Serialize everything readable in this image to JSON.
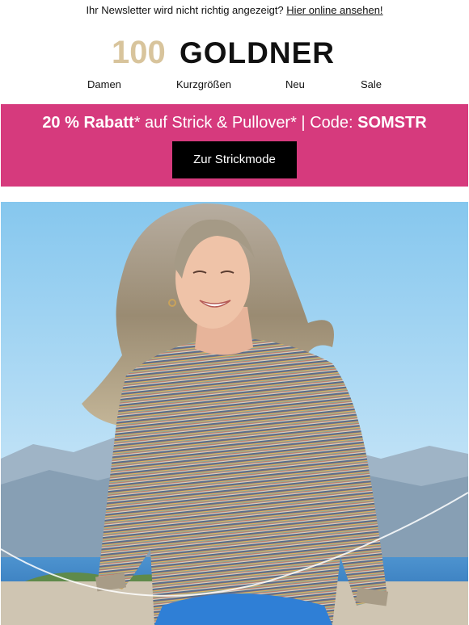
{
  "preheader": {
    "text": "Ihr Newsletter wird nicht richtig angezeigt?",
    "link": "Hier online ansehen!"
  },
  "brand": {
    "anniversary": "100",
    "name": "GOLDNER",
    "gold_color": "#d8c49c"
  },
  "nav": {
    "items": [
      "Damen",
      "Kurzgrößen",
      "Neu",
      "Sale"
    ]
  },
  "promo": {
    "discount": "20 % Rabatt",
    "text_mid": "* auf Strick & Pullover* | Code: ",
    "code": "SOMSTR",
    "button_label": "Zur Strickmode",
    "background": "#d63a7d"
  },
  "hero": {
    "image": "woman-in-striped-knit-sweater-photo"
  }
}
